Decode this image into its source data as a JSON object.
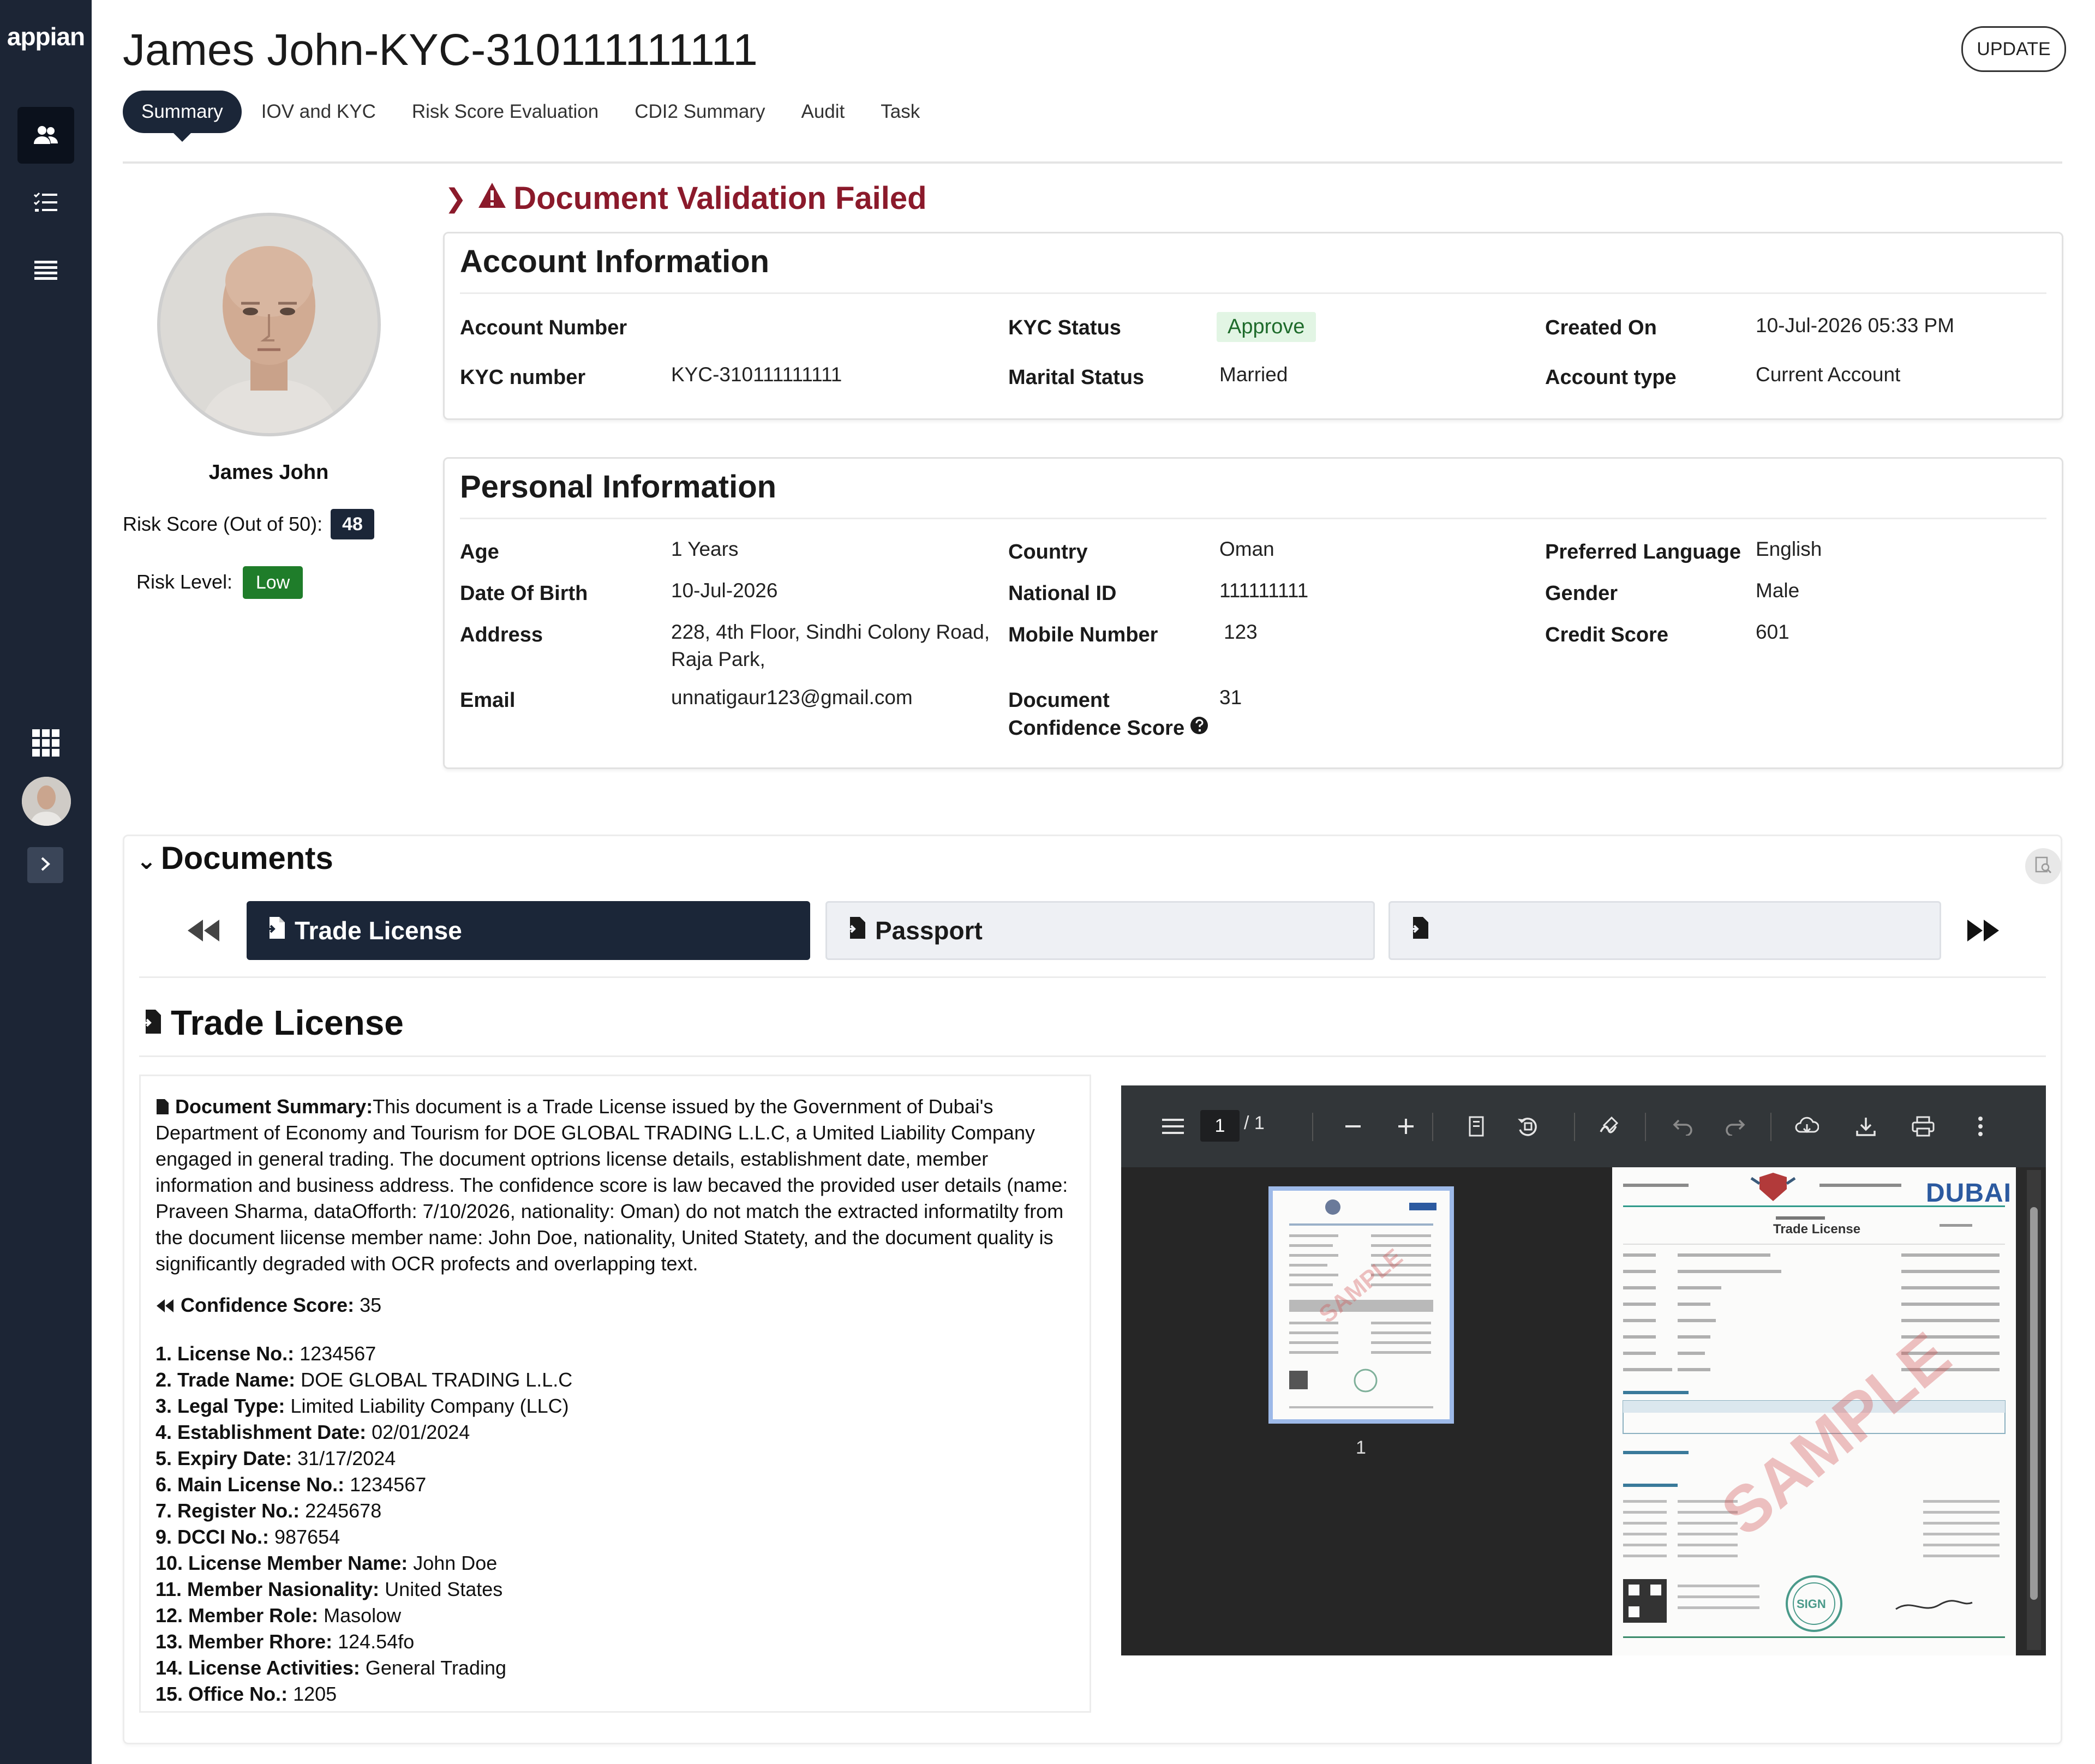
{
  "app": {
    "brand": "appian"
  },
  "header": {
    "title": "James John-KYC-310111111111",
    "update_label": "UPDATE",
    "tabs": [
      "Summary",
      "IOV and KYC",
      "Risk Score Evaluation",
      "CDI2 Summary",
      "Audit",
      "Task"
    ]
  },
  "profile": {
    "name": "James John",
    "risk_score_label": "Risk Score (Out of 50):",
    "risk_score": "48",
    "risk_level_label": "Risk Level:",
    "risk_level": "Low"
  },
  "validation": {
    "message": "Document Validation Failed"
  },
  "account": {
    "title": "Account Information",
    "account_number_label": "Account Number",
    "account_number": "",
    "kyc_number_label": "KYC number",
    "kyc_number": "KYC-310111111111",
    "kyc_status_label": "KYC Status",
    "kyc_status": "Approve",
    "marital_status_label": "Marital Status",
    "marital_status": "Married",
    "created_on_label": "Created On",
    "created_on": "10-Jul-2026 05:33 PM",
    "account_type_label": "Account type",
    "account_type": "Current Account"
  },
  "personal": {
    "title": "Personal Information",
    "age_label": "Age",
    "age": "1 Years",
    "dob_label": "Date Of Birth",
    "dob": "10-Jul-2026",
    "address_label": "Address",
    "address_line1": "228, 4th Floor, Sindhi Colony Road,",
    "address_line2": "Raja Park,",
    "email_label": "Email",
    "email": "unnatigaur123@gmail.com",
    "country_label": "Country",
    "country": "Oman",
    "national_id_label": "National ID",
    "national_id": "111111111",
    "mobile_label": "Mobile Number",
    "mobile": "123",
    "doc_conf_label_line1": "Document",
    "doc_conf_label_line2": "Confidence Score",
    "doc_conf": "31",
    "pref_lang_label": "Preferred Language",
    "pref_lang": "English",
    "gender_label": "Gender",
    "gender": "Male",
    "credit_label": "Credit Score",
    "credit": "601"
  },
  "documents": {
    "title": "Documents",
    "tabs": [
      "Trade License",
      "Passport",
      ""
    ],
    "selected_title": "Trade License",
    "summary_label": "Document Summary:",
    "summary_text": "This document is a Trade License issued by the Government of Dubai's Department of Economy and Tourism for DOE GLOBAL TRADING L.L.C, a Umited Liability Company engaged in general trading. The document optrions license details, establishment date, member information and business address. The confidence score is law becaved the provided user details (name: Praveen Sharma, dataOfforth: 7/10/2026, nationality: Oman) do not match the extracted informatilty from the document liicense member name: John Doe, nationality, United Statety, and the document quality is significantly degraded with OCR profects and overlapping text.",
    "confidence_label": "Confidence Score:",
    "confidence_value": "35",
    "fields": [
      {
        "label": "1. License No.:",
        "value": "1234567"
      },
      {
        "label": "2. Trade Name:",
        "value": "DOE GLOBAL TRADING L.L.C"
      },
      {
        "label": "3. Legal Type:",
        "value": "Limited Liability Company (LLC)"
      },
      {
        "label": "4. Establishment Date:",
        "value": "02/01/2024"
      },
      {
        "label": "5. Expiry Date:",
        "value": "31/17/2024"
      },
      {
        "label": "6. Main License No.:",
        "value": "1234567"
      },
      {
        "label": "7. Register No.:",
        "value": "2245678"
      },
      {
        "label": "9. DCCI No.:",
        "value": "987654"
      },
      {
        "label": "10. License Member Name:",
        "value": "John Doe"
      },
      {
        "label": "11. Member Nasionality:",
        "value": "United States"
      },
      {
        "label": "12. Member Role:",
        "value": "Masolow"
      },
      {
        "label": "13. Member Rhore:",
        "value": "124.54fo"
      },
      {
        "label": "14. License Activities:",
        "value": "General Trading"
      },
      {
        "label": "15. Office No.:",
        "value": "1205"
      }
    ]
  },
  "viewer": {
    "page_current": "1",
    "page_total": "/ 1",
    "thumb_number": "1",
    "doc_header_right": "DUBAI",
    "doc_heading": "Trade License",
    "watermark": "SAMPLE",
    "seal_text": "SIGN"
  },
  "colors": {
    "nav_bg": "#1c2535",
    "accent_dark": "#1b2638",
    "error": "#8b1a2b",
    "risk_low": "#1f7d2a",
    "approve_bg": "#e2f5e4"
  }
}
